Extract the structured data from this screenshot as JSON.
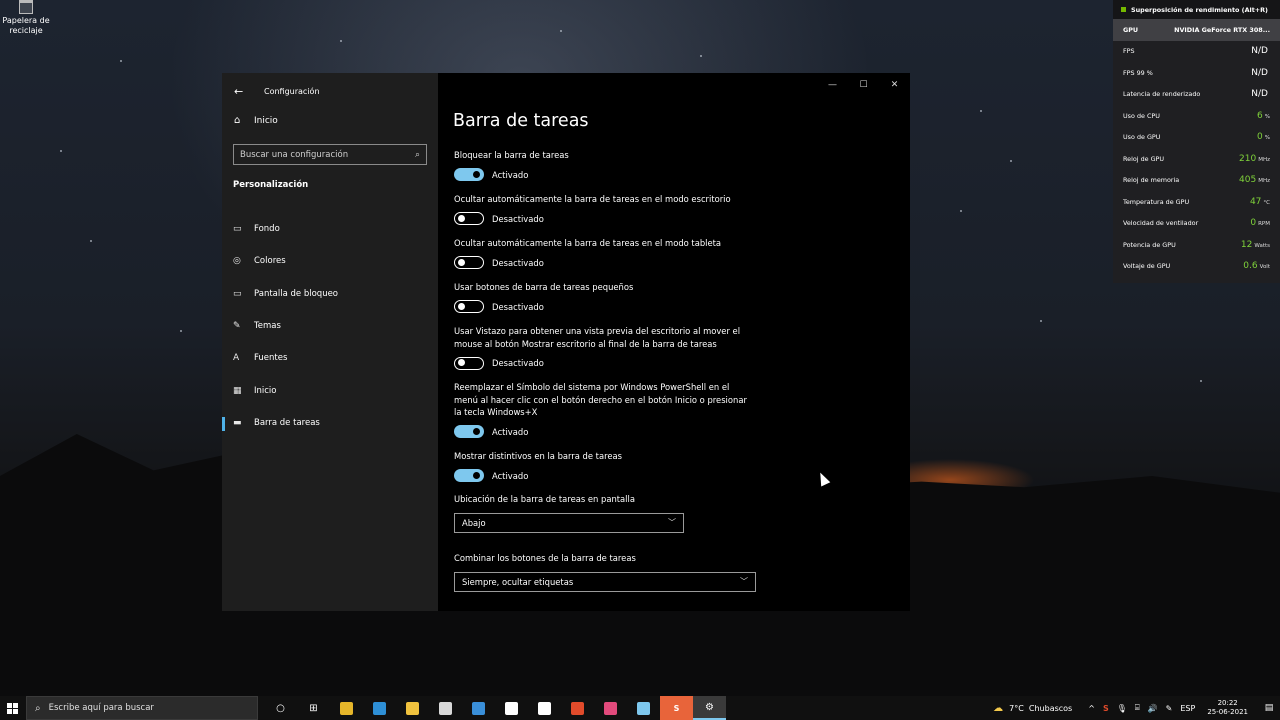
{
  "desktop": {
    "recycle_bin_label": "Papelera de reciclaje"
  },
  "window": {
    "app_title": "Configuración",
    "controls": {
      "minimize": "—",
      "maximize": "☐",
      "close": "✕"
    }
  },
  "sidebar": {
    "home_label": "Inicio",
    "search_placeholder": "Buscar una configuración",
    "section_title": "Personalización",
    "items": [
      {
        "label": "Fondo",
        "icon": "picture-icon",
        "glyph": "▭"
      },
      {
        "label": "Colores",
        "icon": "palette-icon",
        "glyph": "◎"
      },
      {
        "label": "Pantalla de bloqueo",
        "icon": "lock-screen-icon",
        "glyph": "▭"
      },
      {
        "label": "Temas",
        "icon": "themes-icon",
        "glyph": "✎"
      },
      {
        "label": "Fuentes",
        "icon": "fonts-icon",
        "glyph": "A"
      },
      {
        "label": "Inicio",
        "icon": "start-icon",
        "glyph": "▦"
      },
      {
        "label": "Barra de tareas",
        "icon": "taskbar-icon",
        "glyph": "▬"
      }
    ]
  },
  "content": {
    "title": "Barra de tareas",
    "settings": [
      {
        "label": "Bloquear la barra de tareas",
        "state": "Activado"
      },
      {
        "label": "Ocultar automáticamente la barra de tareas en el modo escritorio",
        "state": "Desactivado"
      },
      {
        "label": "Ocultar automáticamente la barra de tareas en el modo tableta",
        "state": "Desactivado"
      },
      {
        "label": "Usar botones de barra de tareas pequeños",
        "state": "Desactivado"
      },
      {
        "label": "Usar Vistazo para obtener una vista previa del escritorio al mover el mouse al botón Mostrar escritorio al final de la barra de tareas",
        "state": "Desactivado"
      },
      {
        "label": "Reemplazar el Símbolo del sistema por Windows PowerShell en el menú al hacer clic con el botón derecho en el botón Inicio o presionar la tecla Windows+X",
        "state": "Activado"
      },
      {
        "label": "Mostrar distintivos en la barra de tareas",
        "state": "Activado"
      }
    ],
    "location": {
      "label": "Ubicación de la barra de tareas en pantalla",
      "value": "Abajo"
    },
    "combine": {
      "label": "Combinar los botones de la barra de tareas",
      "value": "Siempre, ocultar etiquetas"
    }
  },
  "overlay": {
    "title": "Superposición de rendimiento (Alt+R)",
    "gpu_label": "GPU",
    "gpu_name": "NVIDIA GeForce RTX 308...",
    "rows": [
      {
        "label": "FPS",
        "value": "N/D",
        "unit": ""
      },
      {
        "label": "FPS 99 %",
        "value": "N/D",
        "unit": ""
      },
      {
        "label": "Latencia de renderizado",
        "value": "N/D",
        "unit": ""
      },
      {
        "label": "Uso de CPU",
        "value": "6",
        "unit": "%"
      },
      {
        "label": "Uso de GPU",
        "value": "0",
        "unit": "%"
      },
      {
        "label": "Reloj de GPU",
        "value": "210",
        "unit": "MHz"
      },
      {
        "label": "Reloj de memoria",
        "value": "405",
        "unit": "MHz"
      },
      {
        "label": "Temperatura de GPU",
        "value": "47",
        "unit": "°C"
      },
      {
        "label": "Velocidad de ventilador",
        "value": "0",
        "unit": "RPM"
      },
      {
        "label": "Potencia de GPU",
        "value": "12",
        "unit": "Watts"
      },
      {
        "label": "Voltaje de GPU",
        "value": "0.6",
        "unit": "Volt"
      }
    ]
  },
  "taskbar": {
    "search_placeholder": "Escribe aquí para buscar",
    "weather_temp": "7°C",
    "weather_text": "Chubascos",
    "language": "ESP",
    "time": "20:22",
    "date": "25-06-2021",
    "apps": [
      {
        "name": "task-view-icon",
        "glyph": "○",
        "color": ""
      },
      {
        "name": "widgets-icon",
        "glyph": "⊞",
        "color": ""
      },
      {
        "name": "chrome-icon",
        "glyph": "",
        "color": "#e6b62a"
      },
      {
        "name": "edge-icon",
        "glyph": "",
        "color": "#2e8fd6"
      },
      {
        "name": "file-explorer-icon",
        "glyph": "",
        "color": "#f0c23e"
      },
      {
        "name": "store-icon",
        "glyph": "",
        "color": "#d9d9d9"
      },
      {
        "name": "mail-icon",
        "glyph": "",
        "color": "#3a8fd9"
      },
      {
        "name": "editor-icon",
        "glyph": "",
        "color": "#ffffff"
      },
      {
        "name": "xbox-icon",
        "glyph": "",
        "color": "#ffffff"
      },
      {
        "name": "office-icon",
        "glyph": "",
        "color": "#e14b2b"
      },
      {
        "name": "media-icon",
        "glyph": "",
        "color": "#e24a7c"
      },
      {
        "name": "notepad-icon",
        "glyph": "",
        "color": "#7ec8ee"
      },
      {
        "name": "s-app-icon",
        "glyph": "S",
        "color": "#e8643a"
      },
      {
        "name": "settings-icon",
        "glyph": "⚙",
        "color": ""
      }
    ]
  },
  "colors": {
    "accent": "#7ec8ee",
    "nav_indicator": "#4fb2e8",
    "overlay_value": "#7fd23a"
  }
}
